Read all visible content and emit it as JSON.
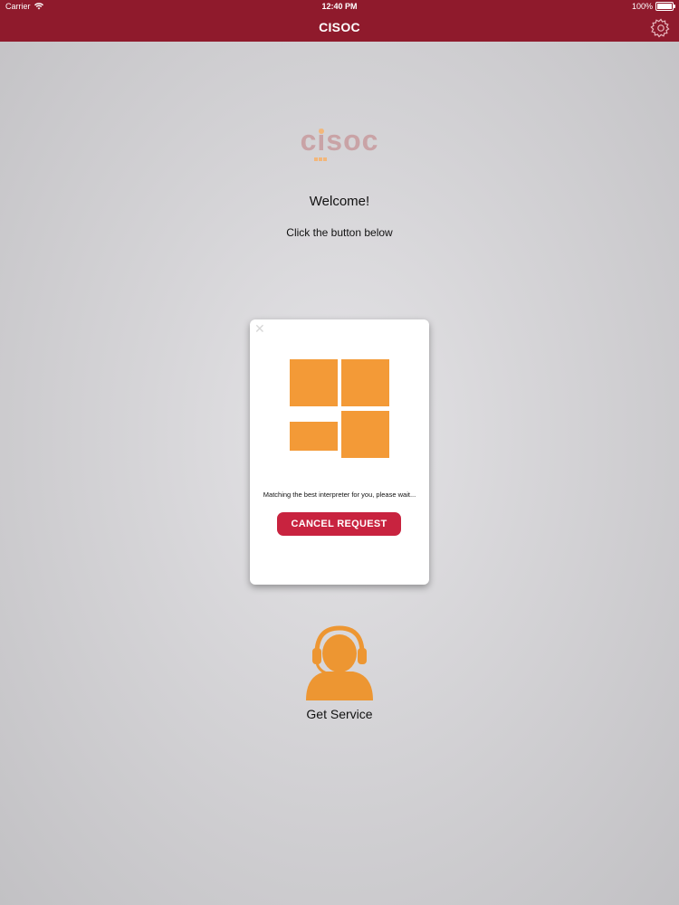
{
  "status_bar": {
    "carrier": "Carrier",
    "time": "12:40 PM",
    "battery": "100%"
  },
  "nav": {
    "title": "CISOC",
    "settings_icon": "gear-icon"
  },
  "logo": {
    "text": "cisoc"
  },
  "main": {
    "welcome": "Welcome!",
    "subtitle": "Click the button below"
  },
  "modal": {
    "close_icon": "close-icon",
    "status_message": "Matching the best interpreter for you, please wait...",
    "cancel_label": "CANCEL REQUEST"
  },
  "service": {
    "icon": "headset-agent-icon",
    "label": "Get Service"
  },
  "colors": {
    "nav_bar": "#8f1a2c",
    "accent_orange": "#f39a37",
    "cancel_button": "#c8233f"
  }
}
